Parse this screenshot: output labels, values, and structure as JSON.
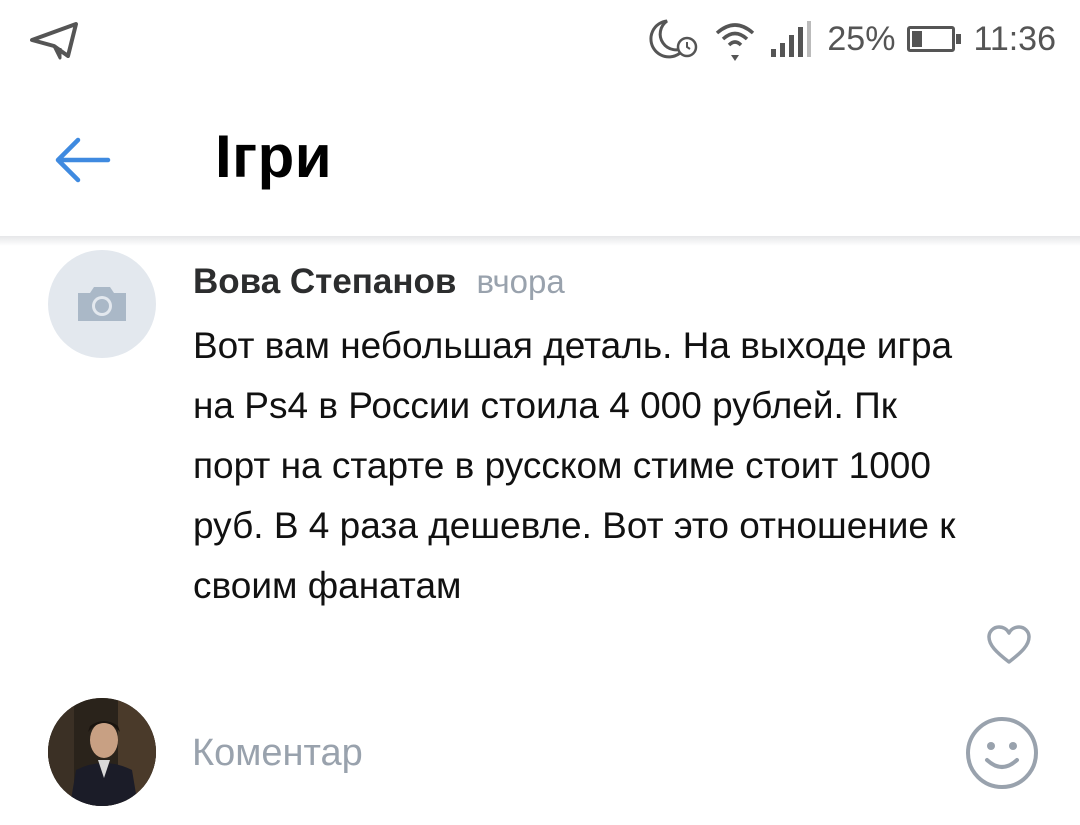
{
  "status_bar": {
    "battery": "25%",
    "battery_level": 0.25,
    "time": "11:36",
    "icons": [
      "telegram-icon",
      "night-alarm-icon",
      "wifi-icon",
      "signal-icon",
      "battery-icon"
    ]
  },
  "header": {
    "title": "Ігри",
    "back_icon": "arrow-left-icon"
  },
  "comment": {
    "author": "Вова Степанов",
    "time": "вчора",
    "text": "Вот вам небольшая деталь. На выходе игра на Ps4 в России стоила 4 000 рублей. Пк порт на старте в русском стиме стоит 1000 руб. В 4 раза дешевле. Вот это отношение к своим фанатам",
    "avatar_icon": "camera-icon",
    "like_icon": "heart-icon"
  },
  "composer": {
    "placeholder": "Коментар",
    "emoji_icon": "smiley-icon"
  },
  "colors": {
    "accent": "#3f8ae0",
    "secondary_text": "#99a2ad",
    "status_icons": "#555555"
  }
}
